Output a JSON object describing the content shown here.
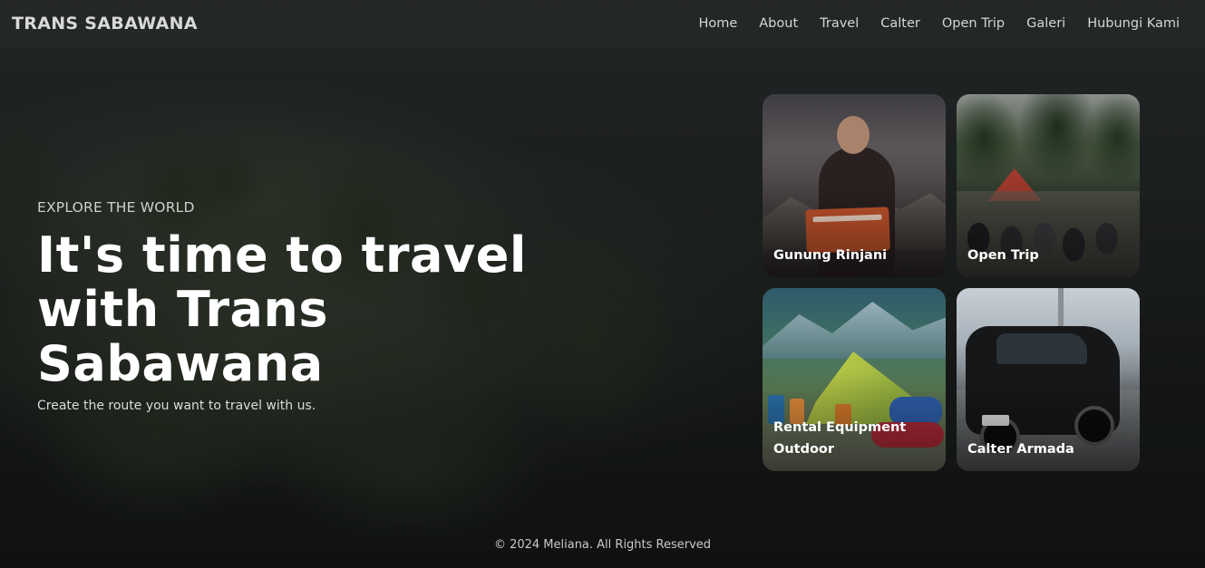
{
  "nav": {
    "brand": "TRANS SABAWANA",
    "items": [
      {
        "label": "Home"
      },
      {
        "label": "About"
      },
      {
        "label": "Travel"
      },
      {
        "label": "Calter"
      },
      {
        "label": "Open Trip"
      },
      {
        "label": "Galeri"
      },
      {
        "label": "Hubungi Kami"
      }
    ]
  },
  "hero": {
    "eyebrow": "EXPLORE THE WORLD",
    "headline": "It's time to travel\nwith Trans Sabawana",
    "subtitle": "Create the route you want to travel with us."
  },
  "cards": [
    {
      "label": "Gunung Rinjani"
    },
    {
      "label": "Open Trip"
    },
    {
      "label": "Rental Equipment Outdoor"
    },
    {
      "label": "Calter Armada"
    }
  ],
  "footer": {
    "copyright": "© 2024 Meliana. All Rights Reserved"
  }
}
